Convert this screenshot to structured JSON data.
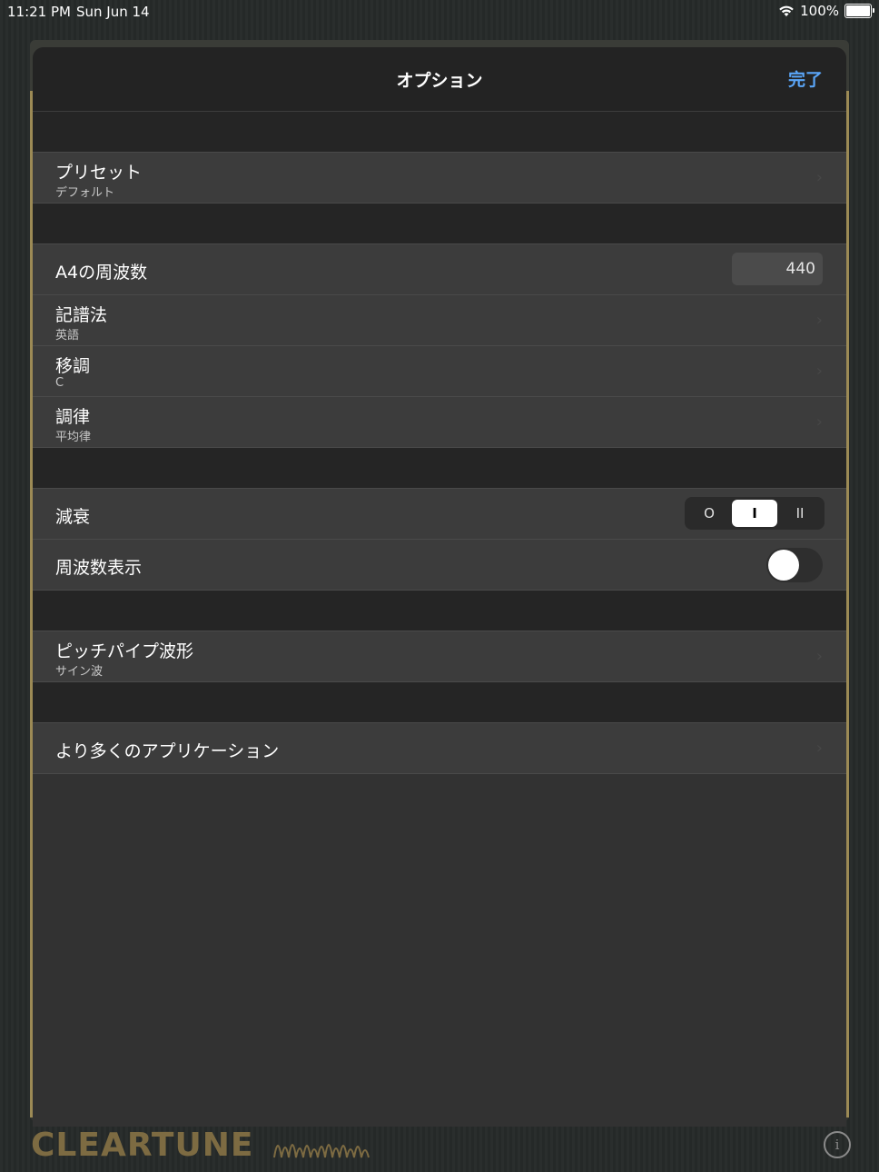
{
  "status_bar": {
    "time": "11:21 PM",
    "date": "Sun Jun 14",
    "battery": "100%"
  },
  "nav": {
    "title": "オプション",
    "done_label": "完了"
  },
  "preset": {
    "label": "プリセット",
    "value": "デフォルト"
  },
  "frequency": {
    "label": "A4の周波数",
    "value": "440"
  },
  "notation": {
    "label": "記譜法",
    "value": "英語"
  },
  "transpose": {
    "label": "移調",
    "value": "C"
  },
  "temperament": {
    "label": "調律",
    "value": "平均律"
  },
  "damping": {
    "label": "減衰",
    "options": [
      "O",
      "I",
      "II"
    ],
    "selected": "I"
  },
  "freq_display": {
    "label": "周波数表示",
    "on": false
  },
  "waveform": {
    "label": "ピッチパイプ波形",
    "value": "サイン波"
  },
  "more_apps": {
    "label": "より多くのアプリケーション"
  },
  "brand": {
    "logo": "CLEARTUNE",
    "accent": "#7d6b42"
  },
  "icons": {
    "wifi": "wifi-icon",
    "battery": "battery-icon",
    "info": "info-icon",
    "chevron": "chevron-right-icon"
  }
}
